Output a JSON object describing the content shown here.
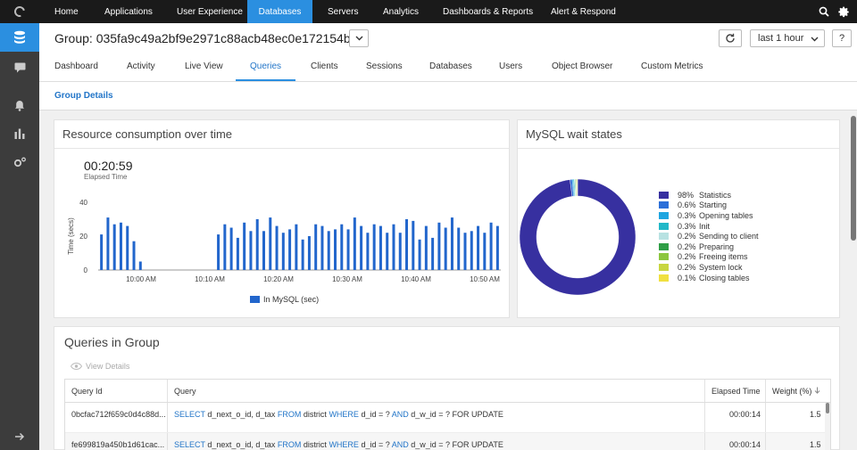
{
  "nav": {
    "items": [
      "Home",
      "Applications",
      "User Experience",
      "Databases",
      "Servers",
      "Analytics",
      "Dashboards & Reports",
      "Alert & Respond"
    ],
    "active": "Databases"
  },
  "header": {
    "group_title": "Group: 035fa9c49a2bf9e2971c88acb48ec0e172154be1",
    "time_range": "last 1 hour",
    "help": "?",
    "tabs": [
      "Dashboard",
      "Activity",
      "Live View",
      "Queries",
      "Clients",
      "Sessions",
      "Databases",
      "Users",
      "Object Browser",
      "Custom Metrics"
    ],
    "active_tab": "Queries"
  },
  "subheader": {
    "link": "Group Details"
  },
  "resource_panel": {
    "title": "Resource consumption over time",
    "elapsed_value": "00:20:59",
    "elapsed_label": "Elapsed Time"
  },
  "wait_panel": {
    "title": "MySQL wait states"
  },
  "chart_data": [
    {
      "type": "bar",
      "ylabel": "Time (secs)",
      "ylim": [
        0,
        40
      ],
      "yticks": [
        "40",
        "20",
        "0"
      ],
      "xticks": [
        "10:00 AM",
        "10:10 AM",
        "10:20 AM",
        "10:30 AM",
        "10:40 AM",
        "10:50 AM"
      ],
      "series": [
        {
          "name": "In MySQL (sec)",
          "color": "#2266cc",
          "values": [
            21,
            31,
            27,
            28,
            26,
            17,
            5,
            0,
            0,
            0,
            0,
            0,
            0,
            0,
            0,
            0,
            0,
            0,
            21,
            27,
            25,
            19,
            28,
            23,
            30,
            23,
            31,
            26,
            22,
            24,
            27,
            18,
            20,
            27,
            26,
            23,
            24,
            27,
            24,
            31,
            26,
            22,
            27,
            26,
            22,
            27,
            22,
            30,
            29,
            18,
            26,
            19,
            28,
            25,
            31,
            25,
            22,
            23,
            26,
            22,
            28,
            26
          ]
        }
      ]
    },
    {
      "type": "pie",
      "donut": true,
      "slices": [
        {
          "label": "Statistics",
          "pct": "98%",
          "value": 98,
          "color": "#3730a0"
        },
        {
          "label": "Starting",
          "pct": "0.6%",
          "value": 0.6,
          "color": "#2c6fd8"
        },
        {
          "label": "Opening tables",
          "pct": "0.3%",
          "value": 0.3,
          "color": "#1ea5e0"
        },
        {
          "label": "Init",
          "pct": "0.3%",
          "value": 0.3,
          "color": "#22b8c8"
        },
        {
          "label": "Sending to client",
          "pct": "0.2%",
          "value": 0.2,
          "color": "#b8e2e2"
        },
        {
          "label": "Preparing",
          "pct": "0.2%",
          "value": 0.2,
          "color": "#2f9e46"
        },
        {
          "label": "Freeing items",
          "pct": "0.2%",
          "value": 0.2,
          "color": "#8cc63f"
        },
        {
          "label": "System lock",
          "pct": "0.2%",
          "value": 0.2,
          "color": "#c8d640"
        },
        {
          "label": "Closing tables",
          "pct": "0.1%",
          "value": 0.1,
          "color": "#f0e040"
        }
      ]
    }
  ],
  "queries": {
    "title": "Queries in Group",
    "view_details": "View Details",
    "columns": [
      "Query Id",
      "Query",
      "Elapsed Time",
      "Weight (%)"
    ],
    "rows": [
      {
        "id": "0bcfac712f659c0d4c88d...",
        "q": [
          "SELECT",
          " d_next_o_id, d_tax ",
          "FROM",
          " district ",
          "WHERE",
          " d_id = ? ",
          "AND",
          " d_w_id = ? FOR UPDATE"
        ],
        "elapsed": "00:00:14",
        "weight": "1.5"
      },
      {
        "id": "fe699819a450b1d61cac...",
        "q": [
          "SELECT",
          " d_next_o_id, d_tax ",
          "FROM",
          " district ",
          "WHERE",
          " d_id = ? ",
          "AND",
          " d_w_id = ? FOR UPDATE"
        ],
        "elapsed": "00:00:14",
        "weight": "1.5"
      }
    ]
  }
}
